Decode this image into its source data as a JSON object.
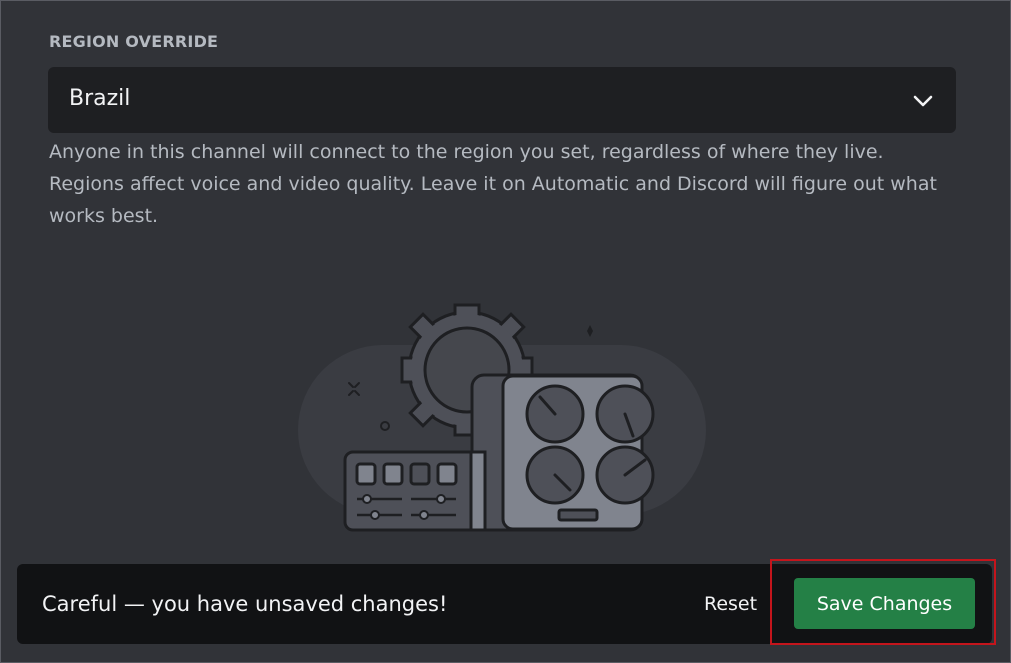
{
  "region": {
    "section_label": "REGION OVERRIDE",
    "selected_value": "Brazil",
    "helper_text": "Anyone in this channel will connect to the region you set, regardless of where they live. Regions affect voice and video quality. Leave it on Automatic and Discord will figure out what works best."
  },
  "notice": {
    "message": "Careful — you have unsaved changes!",
    "reset_label": "Reset",
    "save_label": "Save Changes"
  },
  "colors": {
    "background": "#313338",
    "select_bg": "#1e1f22",
    "notice_bg": "#111214",
    "save_button": "#248046",
    "highlight_border": "#c4151c",
    "illustration_fill": "#4e5058",
    "illustration_stroke": "#1e1f22"
  },
  "icons": {
    "dropdown": "chevron-down-icon"
  }
}
